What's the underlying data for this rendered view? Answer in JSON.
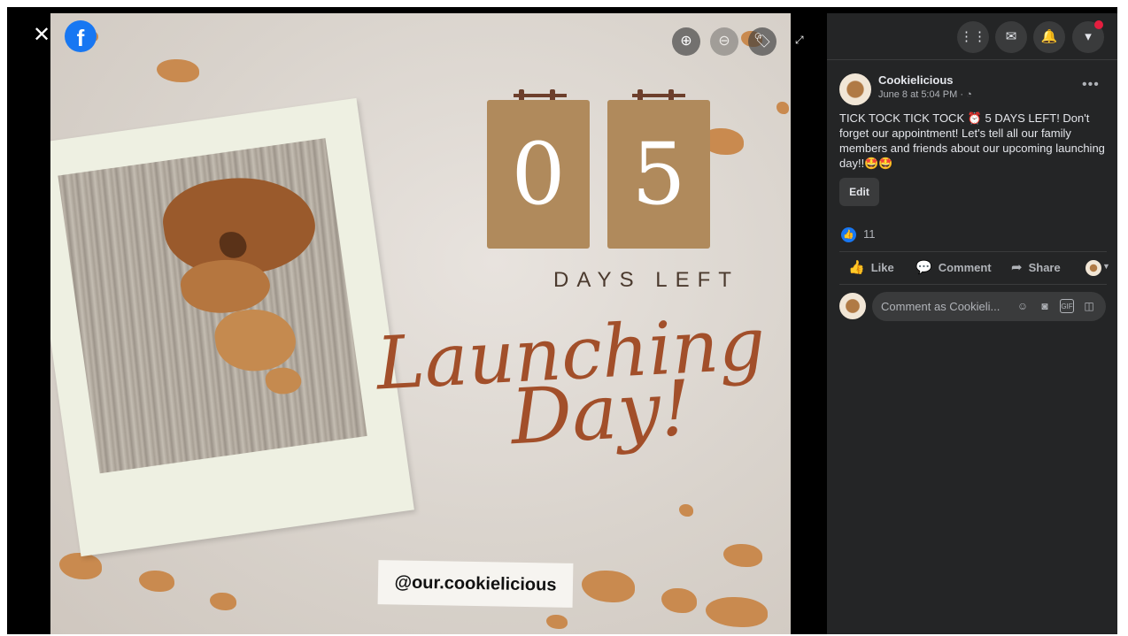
{
  "viewer": {
    "close_icon": "close-icon",
    "facebook_logo": "f",
    "zoom_in_icon": "zoom-in-icon",
    "zoom_out_icon": "zoom-out-icon",
    "tag_icon": "tag-icon",
    "fullscreen_icon": "fullscreen-icon"
  },
  "photo": {
    "digit_1": "0",
    "digit_2": "5",
    "days_left": "DAYS LEFT",
    "title_line_1": "Launching",
    "title_line_2": "Day!",
    "handle": "@our.cookielicious"
  },
  "topbar": {
    "menu_icon": "grid-menu-icon",
    "messenger_icon": "messenger-icon",
    "notifications_icon": "bell-icon",
    "account_icon": "caret-down-icon",
    "notification_dot_color": "#e41e3f"
  },
  "post": {
    "page_name": "Cookielicious",
    "timestamp": "June 8 at 5:04 PM · ",
    "privacy_icon": "globe-icon",
    "more_label": "•••",
    "text": "TICK TOCK TICK TOCK ⏰ 5 DAYS LEFT! Don't forget our appointment! Let's tell all our family members and friends about our upcoming launching day!!🤩🤩",
    "edit_label": "Edit",
    "like_count": "11",
    "actions": {
      "like": "Like",
      "comment": "Comment",
      "share": "Share"
    },
    "comment_placeholder": "Comment as Cookieli..."
  },
  "colors": {
    "panel_bg": "#242526",
    "accent_blue": "#1877f2",
    "flip_card": "#b08a5c",
    "title_rust": "#a24f2a"
  }
}
